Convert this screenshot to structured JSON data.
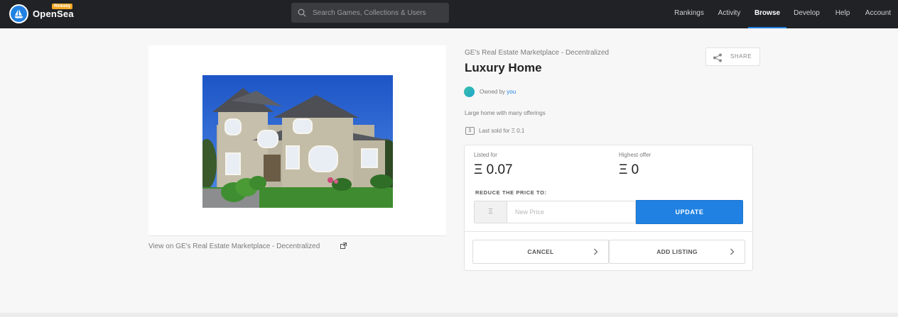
{
  "header": {
    "brand": "OpenSea",
    "network_badge": "Rinkeby",
    "search_placeholder": "Search Games, Collections & Users",
    "nav": [
      {
        "label": "Rankings",
        "active": false
      },
      {
        "label": "Activity",
        "active": false
      },
      {
        "label": "Browse",
        "active": true
      },
      {
        "label": "Develop",
        "active": false
      },
      {
        "label": "Help",
        "active": false
      },
      {
        "label": "Account",
        "active": false
      }
    ],
    "accent_color": "#2081e2"
  },
  "asset": {
    "collection": "GE's Real Estate Marketplace - Decentralized",
    "name": "Luxury Home",
    "share_label": "SHARE",
    "owned_by_prefix": "Owned by",
    "owner": "you",
    "description": "Large home with many offerings",
    "last_sold": "Last sold for Ξ 0.1",
    "view_link": "View on GE's Real Estate Marketplace - Decentralized"
  },
  "listing": {
    "listed_for_label": "Listed for",
    "listed_price": "Ξ 0.07",
    "highest_offer_label": "Highest offer",
    "highest_offer": "Ξ 0",
    "reduce_label": "REDUCE THE PRICE TO:",
    "currency_symbol": "Ξ",
    "price_placeholder": "New Price",
    "update_label": "UPDATE",
    "cancel_label": "CANCEL",
    "add_listing_label": "ADD LISTING"
  },
  "icons": {
    "logo": "opensea-boat-icon",
    "search": "search-icon",
    "share": "share-icon",
    "external": "external-link-icon",
    "dollar": "dollar-bill-icon",
    "chevron": "chevron-right-icon"
  }
}
